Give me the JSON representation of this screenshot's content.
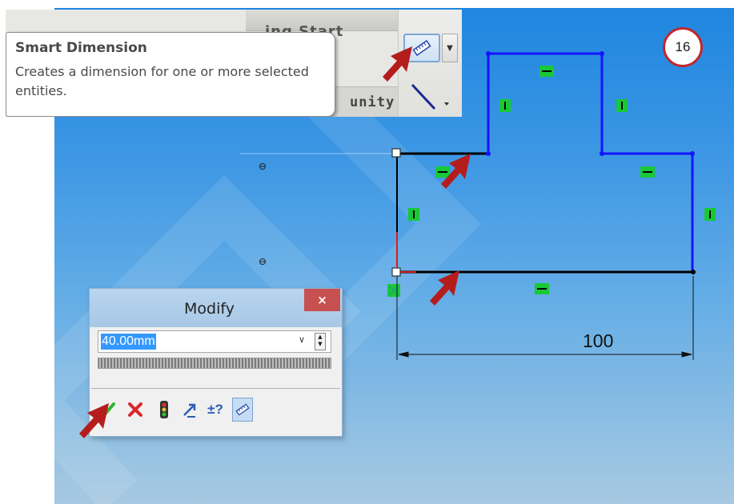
{
  "tooltip": {
    "title": "Smart Dimension",
    "description": "Creates a dimension for one or more selected entities.",
    "toolbar_tab_text": "ing Start",
    "toolbar_tab2_text": "unity"
  },
  "step_badge": "16",
  "sketch": {
    "dimension_value": "100"
  },
  "modify_dialog": {
    "title": "Modify",
    "close_label": "×",
    "value": "40.00mm",
    "dropdown_glyph": "∨",
    "spinner_up": "▲",
    "spinner_down": "▼",
    "plus_minus_label": "±?"
  },
  "colors": {
    "background_blue": "#1f86df",
    "sketch_line": "#1414ff",
    "relation_icon": "#19c837",
    "annotation_arrow": "#b51d1d",
    "badge_ring": "#c0282e"
  },
  "icons": [
    "smart-dimension-icon",
    "line-tool-icon",
    "ok-check-icon",
    "cancel-x-icon",
    "rebuild-light-icon",
    "reverse-direction-icon",
    "tolerance-icon",
    "mark-for-drawing-icon",
    "red-arrow-icon"
  ]
}
